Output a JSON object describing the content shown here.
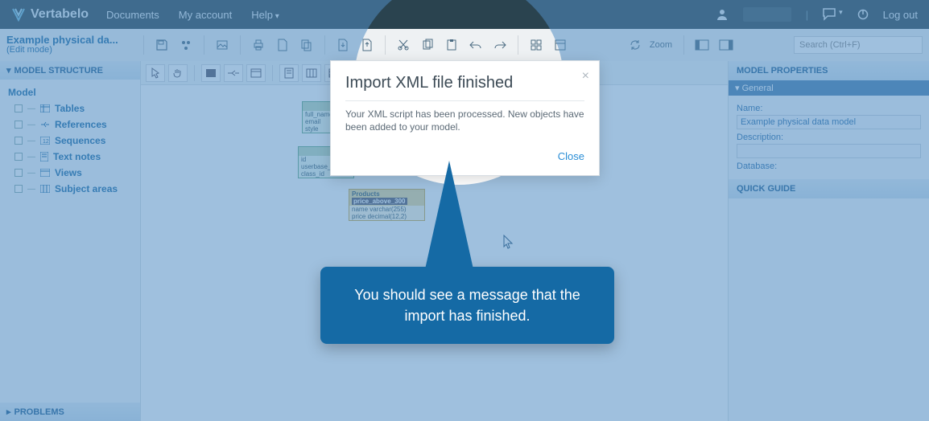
{
  "brand": "Vertabelo",
  "topnav": {
    "documents": "Documents",
    "account": "My account",
    "help": "Help",
    "logout": "Log out"
  },
  "toolbar": {
    "title": "Example physical da...",
    "mode": "(Edit mode)",
    "zoom_label": "Zoom",
    "search_placeholder": "Search (Ctrl+F)"
  },
  "left": {
    "structure_header": "MODEL STRUCTURE",
    "root": "Model",
    "items": [
      {
        "label": "Tables"
      },
      {
        "label": "References"
      },
      {
        "label": "Sequences"
      },
      {
        "label": "Text notes"
      },
      {
        "label": "Views"
      },
      {
        "label": "Subject areas"
      }
    ],
    "problems_header": "PROBLEMS"
  },
  "right": {
    "header": "MODEL PROPERTIES",
    "general": "General",
    "name_label": "Name:",
    "name_value": "Example physical data model",
    "description_label": "Description:",
    "description_value": "",
    "database_label": "Database:",
    "quick_guide": "QUICK GUIDE"
  },
  "canvas": {
    "icons": [
      "pointer",
      "hand",
      "line",
      "table",
      "align",
      "relation",
      "note",
      "area",
      "grid",
      "pattern"
    ],
    "box1": {
      "title": "",
      "rows": [
        "full_name",
        "email",
        "style"
      ]
    },
    "box2": {
      "title": "",
      "rows": [
        "id",
        "userbase_acc",
        "class_id"
      ]
    },
    "box3": {
      "title": "Products",
      "tag": "price_above_300",
      "rows": [
        "name  varchar(255)",
        "price  decimal(12,2)"
      ]
    }
  },
  "modal": {
    "title": "Import XML file finished",
    "body": "Your XML script has been processed. New objects have been added to your model.",
    "close": "Close"
  },
  "callout": {
    "text": "You should see a message that the import has finished."
  }
}
